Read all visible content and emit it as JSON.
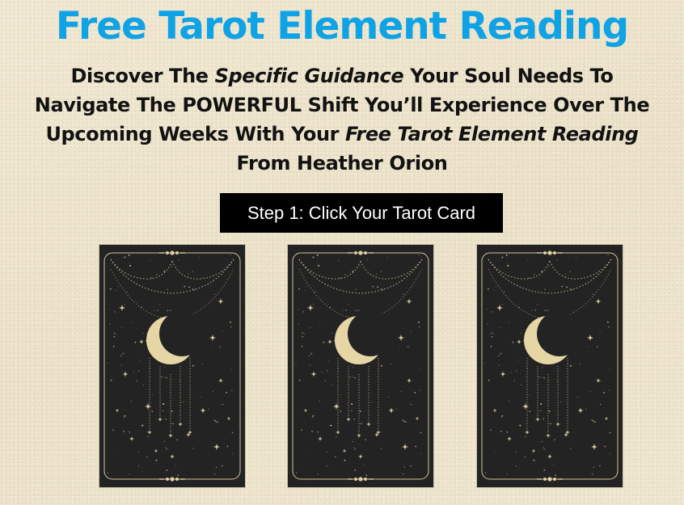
{
  "header": {
    "title": "Free Tarot Element Reading"
  },
  "subtitle": {
    "part1": "Discover The ",
    "em1": "Specific Guidance",
    "part2": " Your Soul Needs To Navigate The POWERFUL Shift You’ll Experience Over The Upcoming Weeks With Your ",
    "em2": "Free Tarot Element Reading",
    "part3": " From Heather Orion"
  },
  "cta": {
    "step_label": "Step 1: Click Your Tarot Card"
  },
  "cards": [
    {
      "icon": "crescent-moon-tarot-card"
    },
    {
      "icon": "crescent-moon-tarot-card"
    },
    {
      "icon": "crescent-moon-tarot-card"
    }
  ],
  "colors": {
    "title": "#0fa3e6",
    "text": "#121212",
    "button_bg": "#000000",
    "button_text": "#ffffff",
    "card_bg": "#232323",
    "card_gold": "#e6d6a6",
    "page_bg": "#efe6cf"
  }
}
